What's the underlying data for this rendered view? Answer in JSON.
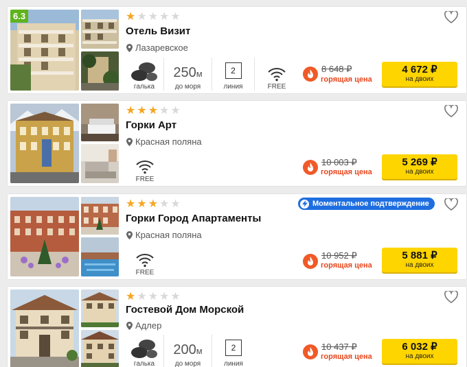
{
  "hotels": [
    {
      "name": "Отель Визит",
      "stars": 1,
      "score": "6.3",
      "location": "Лазаревское",
      "beach_label": "галька",
      "distance_value": "250",
      "distance_unit": "м",
      "distance_label": "до моря",
      "line_number": "2",
      "line_label": "линия",
      "wifi_label": "FREE",
      "old_price": "8 648 ₽",
      "hot_label": "горящая цена",
      "price": "4 672 ₽",
      "price_note": "на двоих"
    },
    {
      "name": "Горки Арт",
      "stars": 3,
      "location": "Красная поляна",
      "wifi_label": "FREE",
      "old_price": "10 003 ₽",
      "hot_label": "горящая цена",
      "price": "5 269 ₽",
      "price_note": "на двоих"
    },
    {
      "name": "Горки Город Апартаменты",
      "stars": 3,
      "badge": "Моментальное подтверждение",
      "location": "Красная поляна",
      "wifi_label": "FREE",
      "old_price": "10 952 ₽",
      "hot_label": "горящая цена",
      "price": "5 881 ₽",
      "price_note": "на двоих"
    },
    {
      "name": "Гостевой Дом Морской",
      "stars": 1,
      "location": "Адлер",
      "beach_label": "галька",
      "distance_value": "200",
      "distance_unit": "м",
      "distance_label": "до моря",
      "line_number": "2",
      "line_label": "линия",
      "old_price": "10 437 ₽",
      "hot_label": "горящая цена",
      "price": "6 032 ₽",
      "price_note": "на двоих"
    }
  ],
  "colors": {
    "price_button": "#ffd500",
    "hot": "#e8471d",
    "badge": "#1e6ee0",
    "score": "#5fb31d",
    "star": "#f5a623"
  }
}
